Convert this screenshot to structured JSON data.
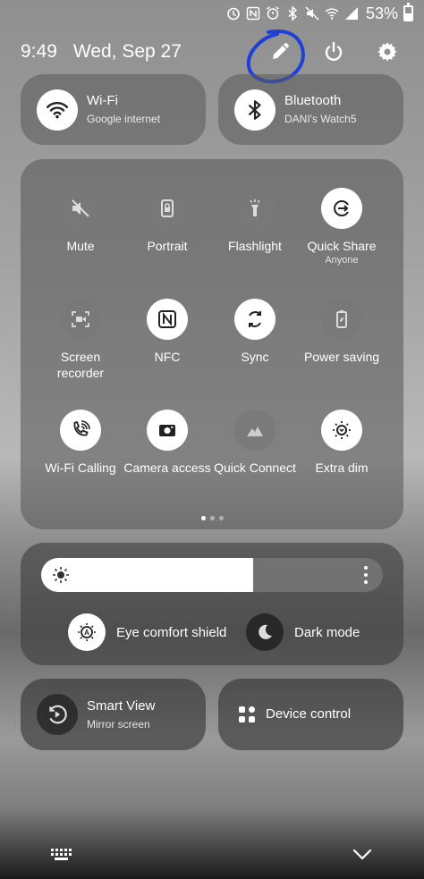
{
  "status": {
    "battery_text": "53%",
    "battery_level": 0.53,
    "icons": [
      "alarm-icon",
      "nfc-icon",
      "vibrate-icon",
      "bluetooth-icon",
      "mute-icon",
      "wifi-calling-icon",
      "signal-icon"
    ]
  },
  "header": {
    "time": "9:49",
    "date": "Wed, Sep 27",
    "actions": [
      "edit-icon",
      "power-icon",
      "settings-icon"
    ]
  },
  "top_tiles": {
    "wifi": {
      "title": "Wi-Fi",
      "subtitle": "Google internet",
      "active": true
    },
    "bluetooth": {
      "title": "Bluetooth",
      "subtitle": "DANI's Watch5",
      "active": true
    }
  },
  "quick_settings": {
    "tiles": [
      {
        "label": "Mute",
        "sub": "",
        "icon": "mute-icon",
        "on": false
      },
      {
        "label": "Portrait",
        "sub": "",
        "icon": "portrait-lock-icon",
        "on": false
      },
      {
        "label": "Flashlight",
        "sub": "",
        "icon": "flashlight-icon",
        "on": false
      },
      {
        "label": "Quick Share",
        "sub": "Anyone",
        "icon": "quick-share-icon",
        "on": true
      },
      {
        "label": "Screen recorder",
        "sub": "",
        "icon": "screen-recorder-icon",
        "on": false
      },
      {
        "label": "NFC",
        "sub": "",
        "icon": "nfc-icon",
        "on": true
      },
      {
        "label": "Sync",
        "sub": "",
        "icon": "sync-icon",
        "on": true
      },
      {
        "label": "Power saving",
        "sub": "",
        "icon": "power-saving-icon",
        "on": false
      },
      {
        "label": "Wi-Fi Calling",
        "sub": "",
        "icon": "wifi-calling-icon",
        "on": true
      },
      {
        "label": "Camera access",
        "sub": "",
        "icon": "camera-icon",
        "on": true
      },
      {
        "label": "Quick Connect",
        "sub": "",
        "icon": "quick-connect-icon",
        "on": false
      },
      {
        "label": "Extra dim",
        "sub": "",
        "icon": "extra-dim-icon",
        "on": true
      }
    ],
    "page_count": 3,
    "current_page": 1
  },
  "brightness": {
    "level": 0.62,
    "eye_comfort_label": "Eye comfort shield",
    "dark_mode_label": "Dark mode"
  },
  "bottom_tiles": {
    "smart_view": {
      "title": "Smart View",
      "subtitle": "Mirror screen"
    },
    "device_control": {
      "title": "Device control"
    }
  },
  "nav": [
    "keyboard-icon",
    "chevron-down-icon"
  ],
  "colors": {
    "annotation": "#1f3fd6",
    "tile_on": "#ffffff",
    "icon_on": "#222222"
  }
}
